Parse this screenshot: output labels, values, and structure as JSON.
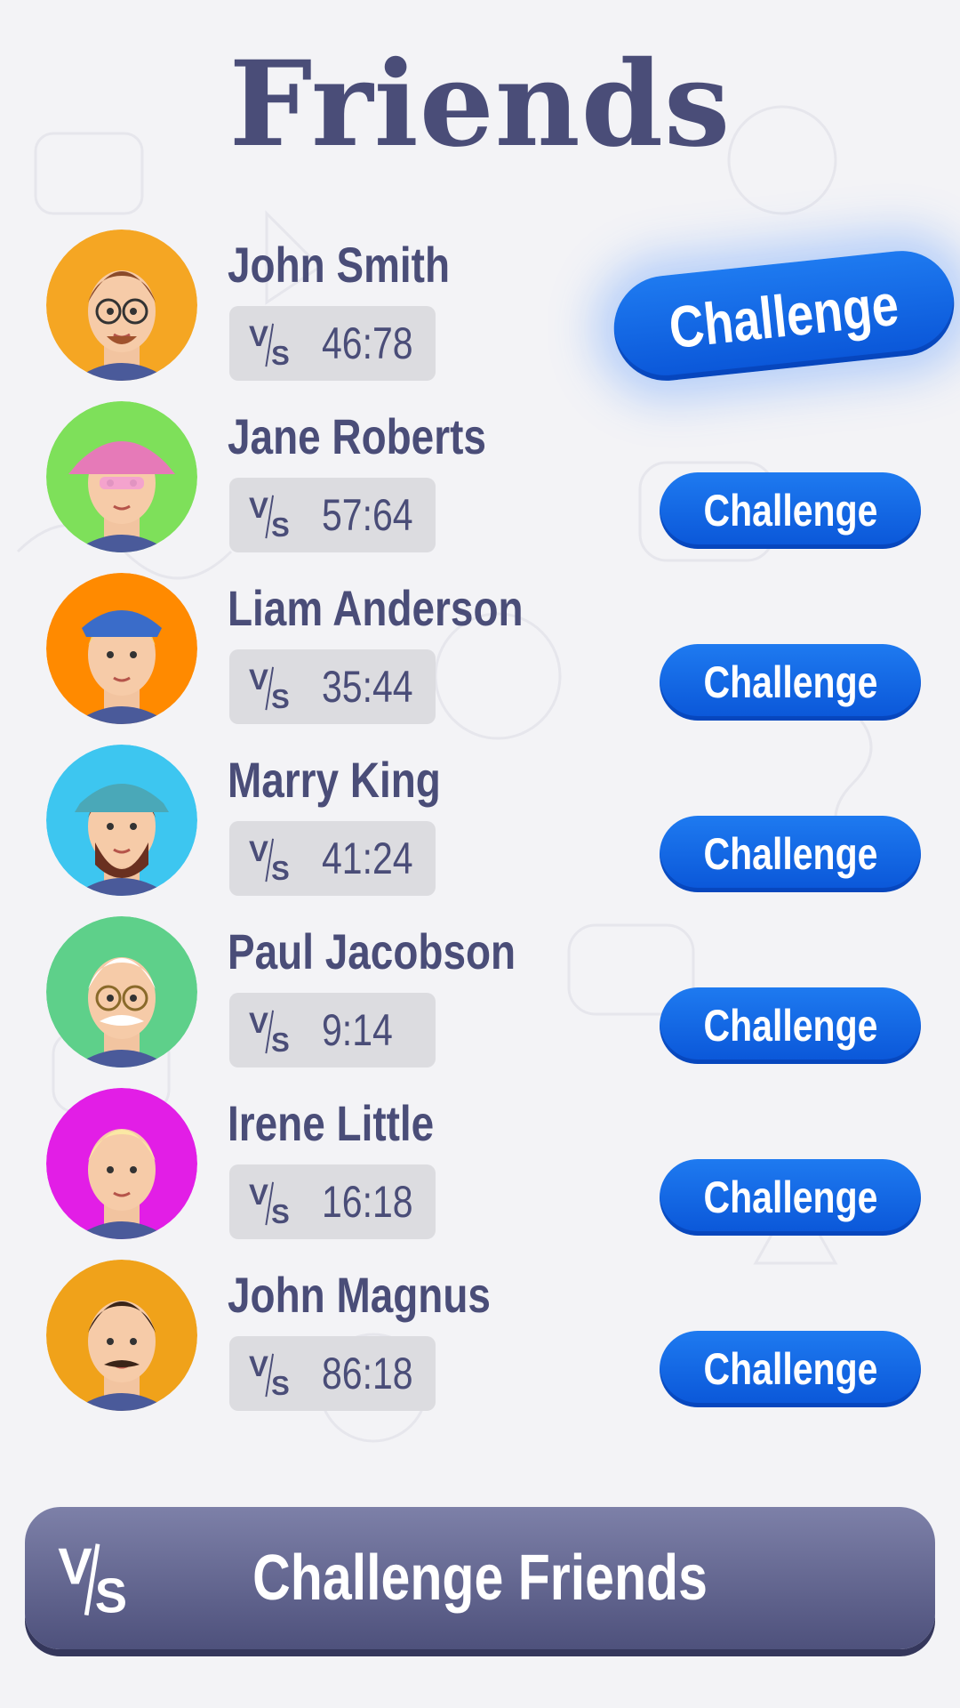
{
  "page": {
    "title": "Friends"
  },
  "colors": {
    "title": "#4a4d78",
    "challenge_button": "#0a62e0",
    "bottom_button": "#5f628c"
  },
  "friends": [
    {
      "name": "John Smith",
      "score": "46:78",
      "challenge_label": "Challenge",
      "avatar_color": "#f5a623",
      "featured": true
    },
    {
      "name": "Jane Roberts",
      "score": "57:64",
      "challenge_label": "Challenge",
      "avatar_color": "#7ee05a",
      "featured": false
    },
    {
      "name": "Liam Anderson",
      "score": "35:44",
      "challenge_label": "Challenge",
      "avatar_color": "#ff8a00",
      "featured": false
    },
    {
      "name": "Marry King",
      "score": "41:24",
      "challenge_label": "Challenge",
      "avatar_color": "#3dc6f0",
      "featured": false
    },
    {
      "name": "Paul Jacobson",
      "score": "9:14",
      "challenge_label": "Challenge",
      "avatar_color": "#5ed08a",
      "featured": false
    },
    {
      "name": "Irene Little",
      "score": "16:18",
      "challenge_label": "Challenge",
      "avatar_color": "#e21ee6",
      "featured": false
    },
    {
      "name": "John Magnus",
      "score": "86:18",
      "challenge_label": "Challenge",
      "avatar_color": "#f0a21a",
      "featured": false
    }
  ],
  "bottom_button": {
    "label": "Challenge Friends",
    "icon": "vs-icon"
  }
}
